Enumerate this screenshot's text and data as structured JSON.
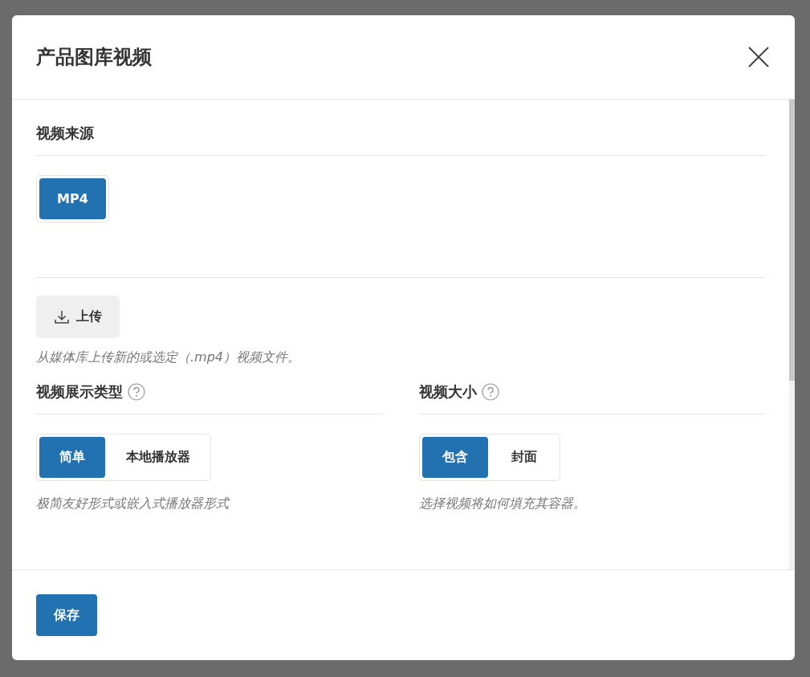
{
  "dialog": {
    "title": "产品图库视频"
  },
  "source": {
    "heading": "视频来源",
    "options": [
      {
        "label": "MP4",
        "selected": true
      }
    ]
  },
  "upload": {
    "button": "上传",
    "hint": "从媒体库上传新的或选定（.mp4）视频文件。"
  },
  "display_type": {
    "heading": "视频展示类型",
    "options": [
      {
        "label": "简单",
        "selected": true
      },
      {
        "label": "本地播放器",
        "selected": false
      }
    ],
    "hint": "极简友好形式或嵌入式播放器形式"
  },
  "size": {
    "heading": "视频大小",
    "options": [
      {
        "label": "包含",
        "selected": true
      },
      {
        "label": "封面",
        "selected": false
      }
    ],
    "hint": "选择视频将如何填充其容器。"
  },
  "footer": {
    "save": "保存"
  }
}
